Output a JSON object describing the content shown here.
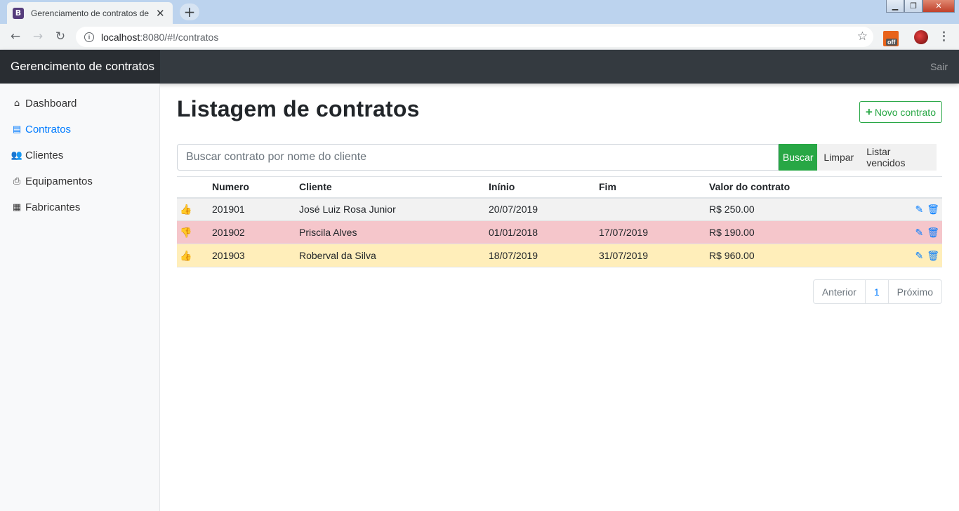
{
  "browser": {
    "tab_title": "Gerenciamento de contratos de l",
    "tab_favicon": "B",
    "url_host": "localhost",
    "url_path": ":8080/#!/contratos",
    "ext_badge": "off"
  },
  "navbar": {
    "brand": "Gerencimento de contratos",
    "logout": "Sair"
  },
  "sidebar": {
    "items": [
      {
        "label": "Dashboard",
        "icon": "home-icon"
      },
      {
        "label": "Contratos",
        "icon": "file-icon",
        "active": true
      },
      {
        "label": "Clientes",
        "icon": "users-icon"
      },
      {
        "label": "Equipamentos",
        "icon": "printer-icon"
      },
      {
        "label": "Fabricantes",
        "icon": "building-icon"
      }
    ]
  },
  "main": {
    "title": "Listagem de contratos",
    "new_button": "Novo contrato",
    "search": {
      "placeholder": "Buscar contrato por nome do cliente",
      "value": "",
      "search_button": "Buscar",
      "clear_button": "Limpar",
      "overdue_button": "Listar vencidos"
    },
    "table": {
      "headers": [
        "Numero",
        "Cliente",
        "Inínio",
        "Fim",
        "Valor do contrato"
      ],
      "rows": [
        {
          "numero": "201901",
          "cliente": "José Luiz Rosa Junior",
          "inicio": "20/07/2019",
          "fim": "",
          "valor": "R$ 250.00",
          "status": "thumbs-up"
        },
        {
          "numero": "201902",
          "cliente": "Priscila Alves",
          "inicio": "01/01/2018",
          "fim": "17/07/2019",
          "valor": "R$ 190.00",
          "status": "thumbs-down"
        },
        {
          "numero": "201903",
          "cliente": "Roberval da Silva",
          "inicio": "18/07/2019",
          "fim": "31/07/2019",
          "valor": "R$ 960.00",
          "status": "thumbs-up"
        }
      ]
    },
    "pagination": {
      "prev": "Anterior",
      "page": "1",
      "next": "Próximo"
    }
  },
  "colors": {
    "success": "#28a745",
    "danger": "#dc3545",
    "primary": "#007bff",
    "navbar": "#343a40"
  }
}
